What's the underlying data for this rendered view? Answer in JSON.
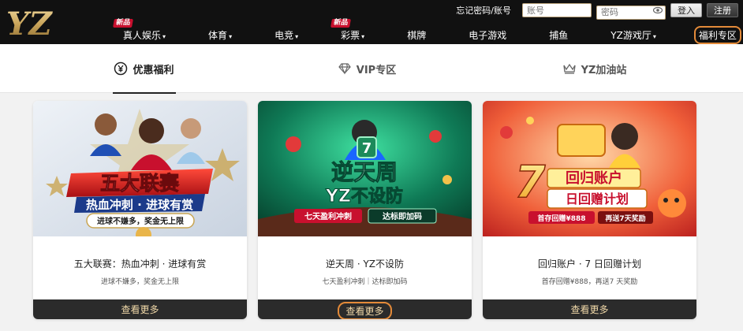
{
  "header": {
    "logo_text": "YZ",
    "forgot_label": "忘记密码/账号",
    "account_placeholder": "账号",
    "password_placeholder": "密码",
    "login_label": "登入",
    "register_label": "注册"
  },
  "nav": {
    "items": [
      {
        "label": "真人娱乐",
        "badge": "新品",
        "caret": "▾"
      },
      {
        "label": "体育",
        "caret": "▾"
      },
      {
        "label": "电竞",
        "caret": "▾"
      },
      {
        "label": "彩票",
        "badge": "新品",
        "caret": "▾"
      },
      {
        "label": "棋牌"
      },
      {
        "label": "电子游戏"
      },
      {
        "label": "捕鱼"
      },
      {
        "label": "YZ游戏厅",
        "caret": "▾"
      },
      {
        "label": "福利专区"
      }
    ]
  },
  "tabs": [
    {
      "label": "优惠福利",
      "icon": "yen-circle-icon"
    },
    {
      "label": "VIP专区",
      "icon": "diamond-icon"
    },
    {
      "label": "YZ加油站",
      "icon": "crown-icon"
    }
  ],
  "cards": [
    {
      "banner": {
        "headline": "五大联赛",
        "line2": "热血冲刺 · 进球有赏",
        "pill": "进球不嫌多，奖金无上限"
      },
      "title": "五大联赛：热血冲刺 · 进球有赏",
      "subtitle": "进球不嫌多，奖金无上限",
      "more_label": "查看更多"
    },
    {
      "banner": {
        "headline": "逆天周",
        "line2": "YZ不设防",
        "pill_left": "七天盈利冲刺",
        "pill_right": "达标即加码",
        "badge": "7"
      },
      "title": "逆天周 · YZ不设防",
      "subtitle": "七天盈利冲刺｜达标即加码",
      "more_label": "查看更多"
    },
    {
      "banner": {
        "headline": "回归账户",
        "line2": "日回赠计划",
        "big_num": "7",
        "pill_left": "首存回赠¥888",
        "pill_right": "再送7天奖励"
      },
      "title": "回归账户 · 7 日回赠计划",
      "subtitle": "首存回赠¥888，再送7 天奖励",
      "more_label": "查看更多"
    }
  ],
  "colors": {
    "accent": "#e38a39",
    "header_bg": "#111111",
    "gold": "#d4b06a"
  }
}
